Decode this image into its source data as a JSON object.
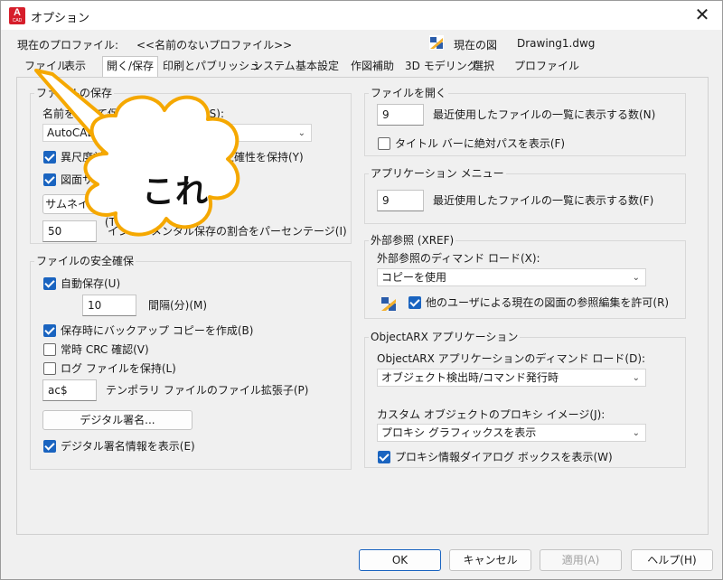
{
  "window": {
    "title": "オプション",
    "app_icon_letter": "A",
    "app_icon_sub": "CAD"
  },
  "profile": {
    "label": "現在のプロファイル:",
    "value": "<<名前のないプロファイル>>",
    "drawing_label": "現在の図",
    "drawing_value": "Drawing1.dwg"
  },
  "tabs": [
    "ファイル",
    "表示",
    "開く/保存",
    "印刷とパブリッシュ",
    "システム",
    "基本設定",
    "作図補助",
    "3D モデリング",
    "選択",
    "プロファイル"
  ],
  "file_save": {
    "title": "ファイルの保存",
    "format_label": "名前を付けて保存のファイル形式(S):",
    "format_value": "AutoCAD 図面 (*.dwg)",
    "annot_check_label": "異尺度対応オブジェクトの表示の正確性を保持(Y)",
    "size_check_label": "図面サイズの互換性を保持(G)",
    "thumbnail_button": "サムネイル プレビューの設定(T)...",
    "incremental_value": "50",
    "incremental_label": "インクリメンタル保存の割合をパーセンテージ(I)"
  },
  "safety": {
    "title": "ファイルの安全確保",
    "autosave_label": "自動保存(U)",
    "interval_value": "10",
    "interval_label": "間隔(分)(M)",
    "backup_label": "保存時にバックアップ コピーを作成(B)",
    "crc_label": "常時 CRC 確認(V)",
    "log_label": "ログ ファイルを保持(L)",
    "ext_value": "ac$",
    "ext_label": "テンポラリ ファイルのファイル拡張子(P)",
    "digsig_button": "デジタル署名...",
    "digsig_info_label": "デジタル署名情報を表示(E)"
  },
  "file_open": {
    "title": "ファイルを開く",
    "recent_value": "9",
    "recent_label": "最近使用したファイルの一覧に表示する数(N)",
    "fullpath_label": "タイトル バーに絶対パスを表示(F)"
  },
  "app_menu": {
    "title": "アプリケーション メニュー",
    "recent_value": "9",
    "recent_label": "最近使用したファイルの一覧に表示する数(F)"
  },
  "xref": {
    "title": "外部参照 (XREF)",
    "demand_label": "外部参照のディマンド ロード(X):",
    "demand_value": "コピーを使用",
    "allow_label": "他のユーザによる現在の図面の参照編集を許可(R)"
  },
  "arx": {
    "title": "ObjectARX アプリケーション",
    "demand_label": "ObjectARX アプリケーションのディマンド ロード(D):",
    "demand_value": "オブジェクト検出時/コマンド発行時",
    "proxy_label": "カスタム オブジェクトのプロキシ イメージ(J):",
    "proxy_value": "プロキシ グラフィックスを表示",
    "proxy_dialog_label": "プロキシ情報ダイアログ ボックスを表示(W)"
  },
  "footer": {
    "ok": "OK",
    "cancel": "キャンセル",
    "apply": "適用(A)",
    "help": "ヘルプ(H)"
  },
  "callout": {
    "text": "これ",
    "color": "#f5a800"
  },
  "colors": {
    "accent": "#1a64c0",
    "app_icon": "#d61e2b"
  }
}
